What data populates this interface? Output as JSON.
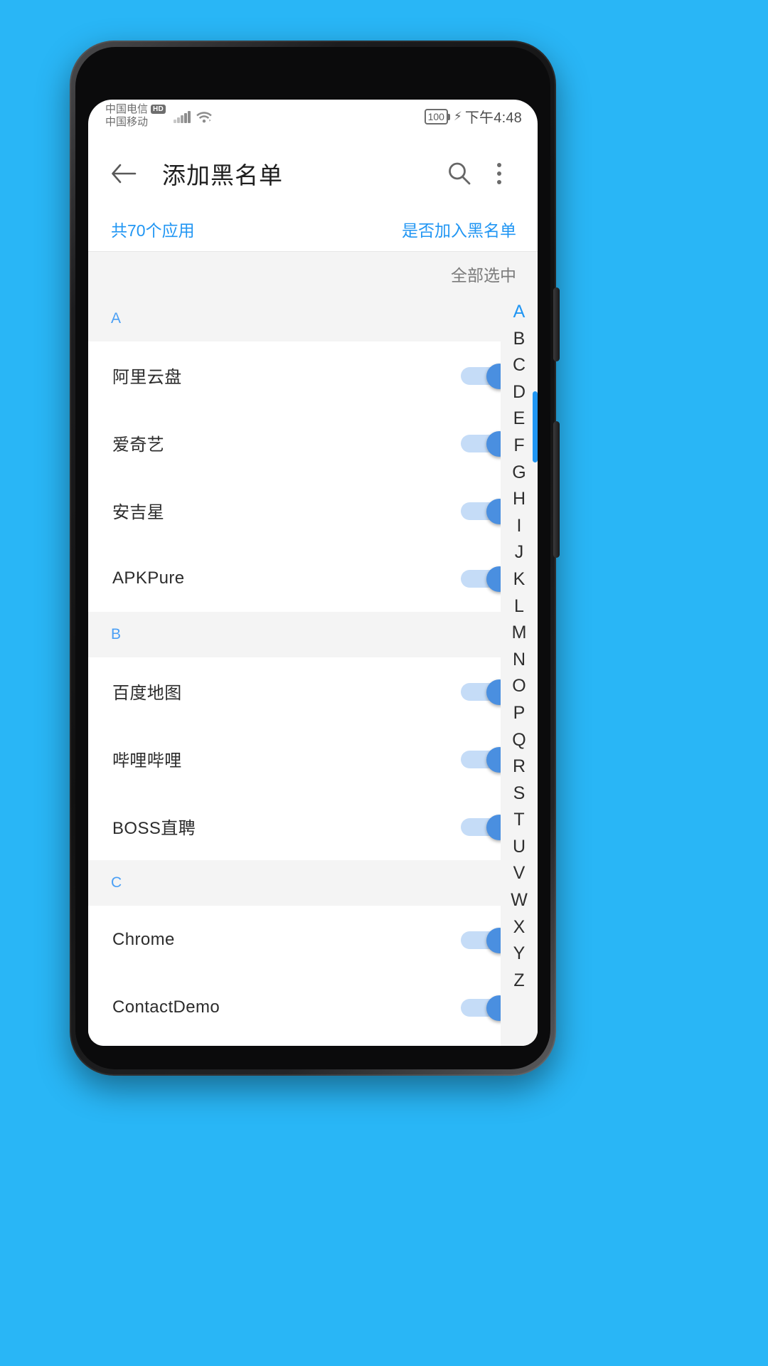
{
  "statusbar": {
    "carrier_primary": "中国电信",
    "hd_badge": "HD",
    "carrier_secondary": "中国移动",
    "battery_level": "100",
    "charging_icon": "⚡",
    "time": "下午4:48",
    "signal_icon": "signal-bars-icon",
    "wifi_icon": "wifi-icon"
  },
  "appbar": {
    "back_icon": "back-arrow-icon",
    "title": "添加黑名单",
    "search_icon": "search-icon",
    "overflow_icon": "more-vertical-icon"
  },
  "inforow": {
    "count_label": "共70个应用",
    "action_label": "是否加入黑名单"
  },
  "selectall": {
    "label": "全部选中"
  },
  "sections": [
    {
      "letter": "A",
      "apps": [
        {
          "name": "阿里云盘",
          "enabled": true
        },
        {
          "name": "爱奇艺",
          "enabled": true
        },
        {
          "name": "安吉星",
          "enabled": true
        },
        {
          "name": "APKPure",
          "enabled": true
        }
      ]
    },
    {
      "letter": "B",
      "apps": [
        {
          "name": "百度地图",
          "enabled": true
        },
        {
          "name": "哔哩哔哩",
          "enabled": true
        },
        {
          "name": "BOSS直聘",
          "enabled": true
        }
      ]
    },
    {
      "letter": "C",
      "apps": [
        {
          "name": "Chrome",
          "enabled": true
        },
        {
          "name": "ContactDemo",
          "enabled": true
        }
      ]
    }
  ],
  "index_bar": {
    "letters": [
      "A",
      "B",
      "C",
      "D",
      "E",
      "F",
      "G",
      "H",
      "I",
      "J",
      "K",
      "L",
      "M",
      "N",
      "O",
      "P",
      "Q",
      "R",
      "S",
      "T",
      "U",
      "V",
      "W",
      "X",
      "Y",
      "Z"
    ],
    "active": "A"
  },
  "colors": {
    "background": "#29b6f6",
    "accent_blue": "#2196f3",
    "section_letter": "#4a9ff5",
    "switch_track": "#c5dcf7",
    "switch_thumb": "#4a8fe0",
    "section_bg": "#f4f4f4"
  }
}
